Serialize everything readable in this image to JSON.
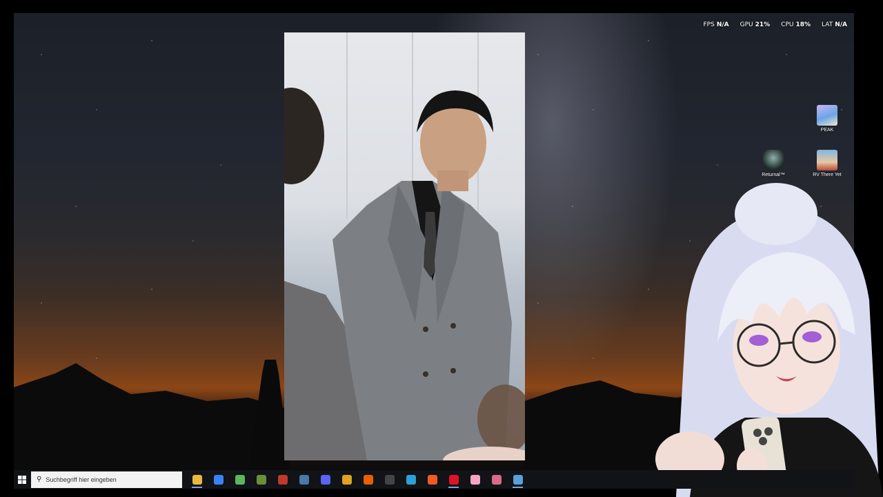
{
  "overlay": {
    "stats": [
      {
        "label": "FPS",
        "value": "N/A"
      },
      {
        "label": "GPU",
        "value": "21%"
      },
      {
        "label": "CPU",
        "value": "18%"
      },
      {
        "label": "LAT",
        "value": "N/A"
      }
    ]
  },
  "desktop": {
    "icons": [
      {
        "label": "PEAK",
        "icon": "peak-game-icon"
      },
      {
        "label": "Returnal™",
        "icon": "returnal-game-icon"
      },
      {
        "label": "RV There Yet",
        "icon": "rv-there-yet-game-icon"
      }
    ]
  },
  "taskbar": {
    "search_placeholder": "Suchbegriff hier eingeben",
    "apps": [
      {
        "icon": "file-explorer-icon",
        "color": "#e8b93c"
      },
      {
        "icon": "store-icon",
        "color": "#3b82f6"
      },
      {
        "icon": "android-app-icon",
        "color": "#5cb85c"
      },
      {
        "icon": "minecraft-icon",
        "color": "#6b8e3a"
      },
      {
        "icon": "media-app-icon",
        "color": "#c0392b"
      },
      {
        "icon": "steam-icon",
        "color": "#4a78a8"
      },
      {
        "icon": "discord-icon",
        "color": "#5865f2"
      },
      {
        "icon": "chrome-icon",
        "color": "#e0a21f"
      },
      {
        "icon": "firefox-icon",
        "color": "#e66000"
      },
      {
        "icon": "obs-icon",
        "color": "#444444"
      },
      {
        "icon": "wizard-app-icon",
        "color": "#2f9fd8"
      },
      {
        "icon": "brave-icon",
        "color": "#f25a24"
      },
      {
        "icon": "opera-icon",
        "color": "#e0122a"
      },
      {
        "icon": "pink-app-icon",
        "color": "#f4a6c1"
      },
      {
        "icon": "controller-app-icon",
        "color": "#d96a8a"
      },
      {
        "icon": "steam-alt-icon",
        "color": "#5aa0d8"
      }
    ]
  },
  "colors": {
    "taskbar_bg": "#111317",
    "overlay_text": "#ffffff",
    "search_bg": "#f3f3f3"
  }
}
